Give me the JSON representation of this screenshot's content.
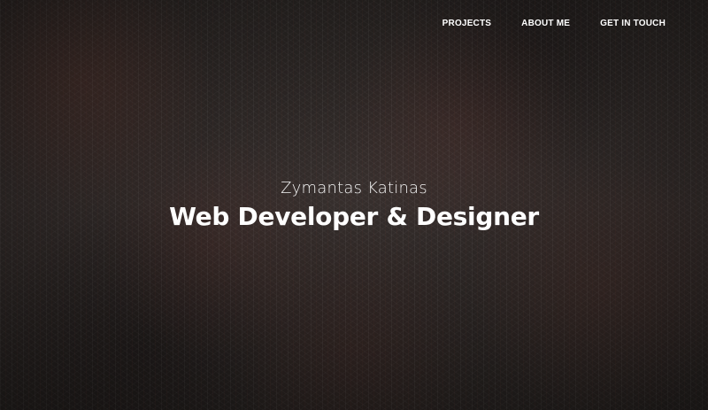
{
  "nav": {
    "items": [
      {
        "label": "PROJECTS"
      },
      {
        "label": "ABOUT ME"
      },
      {
        "label": "GET IN TOUCH"
      }
    ]
  },
  "hero": {
    "name": "Zymantas Katinas",
    "title": "Web Developer & Designer",
    "background": "dark forest treetops photo"
  },
  "colors": {
    "text": "#ffffff",
    "background": "#2b2725"
  }
}
